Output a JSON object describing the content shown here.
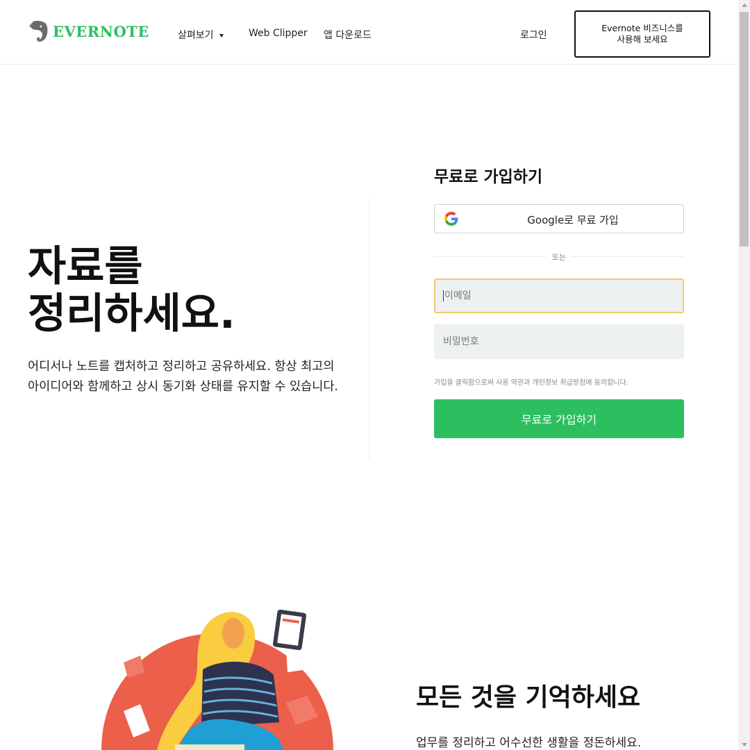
{
  "colors": {
    "brand_green": "#2dbe60",
    "focus_border": "#f1c96b",
    "illustration_red": "#ec5f4a",
    "illustration_blue": "#1f9fd3",
    "illustration_yellow": "#f9cd3f"
  },
  "header": {
    "logo": {
      "icon": "elephant-icon",
      "text": "EVERNOTE"
    },
    "nav": [
      {
        "label": "살펴보기",
        "has_dropdown": true
      },
      {
        "label": "Web Clipper"
      },
      {
        "label": "앱 다운로드"
      }
    ],
    "login_label": "로그인",
    "business_button": {
      "line1": "Evernote 비즈니스를",
      "line2": "사용해 보세요"
    }
  },
  "hero": {
    "title_line1": "자료를",
    "title_line2": "정리하세요.",
    "description": "어디서나 노트를 캡처하고 정리하고 공유하세요. 항상 최고의 아이디어와 함께하고 상시 동기화 상태를 유지할 수 있습니다."
  },
  "signup": {
    "heading": "무료로 가입하기",
    "google_button_label": "Google로 무료 가입",
    "google_icon": "google-g-icon",
    "or_label": "또는",
    "email_placeholder": "이메일",
    "password_placeholder": "비밀번호",
    "terms_text": "가입을 클릭함으로써 사용 약관과 개인정보 취급방침에 동의합니다.",
    "submit_label": "무료로 가입하기"
  },
  "section": {
    "title": "모든 것을 기억하세요",
    "description": "업무를 정리하고 어수선한 생활을 정돈하세요."
  }
}
